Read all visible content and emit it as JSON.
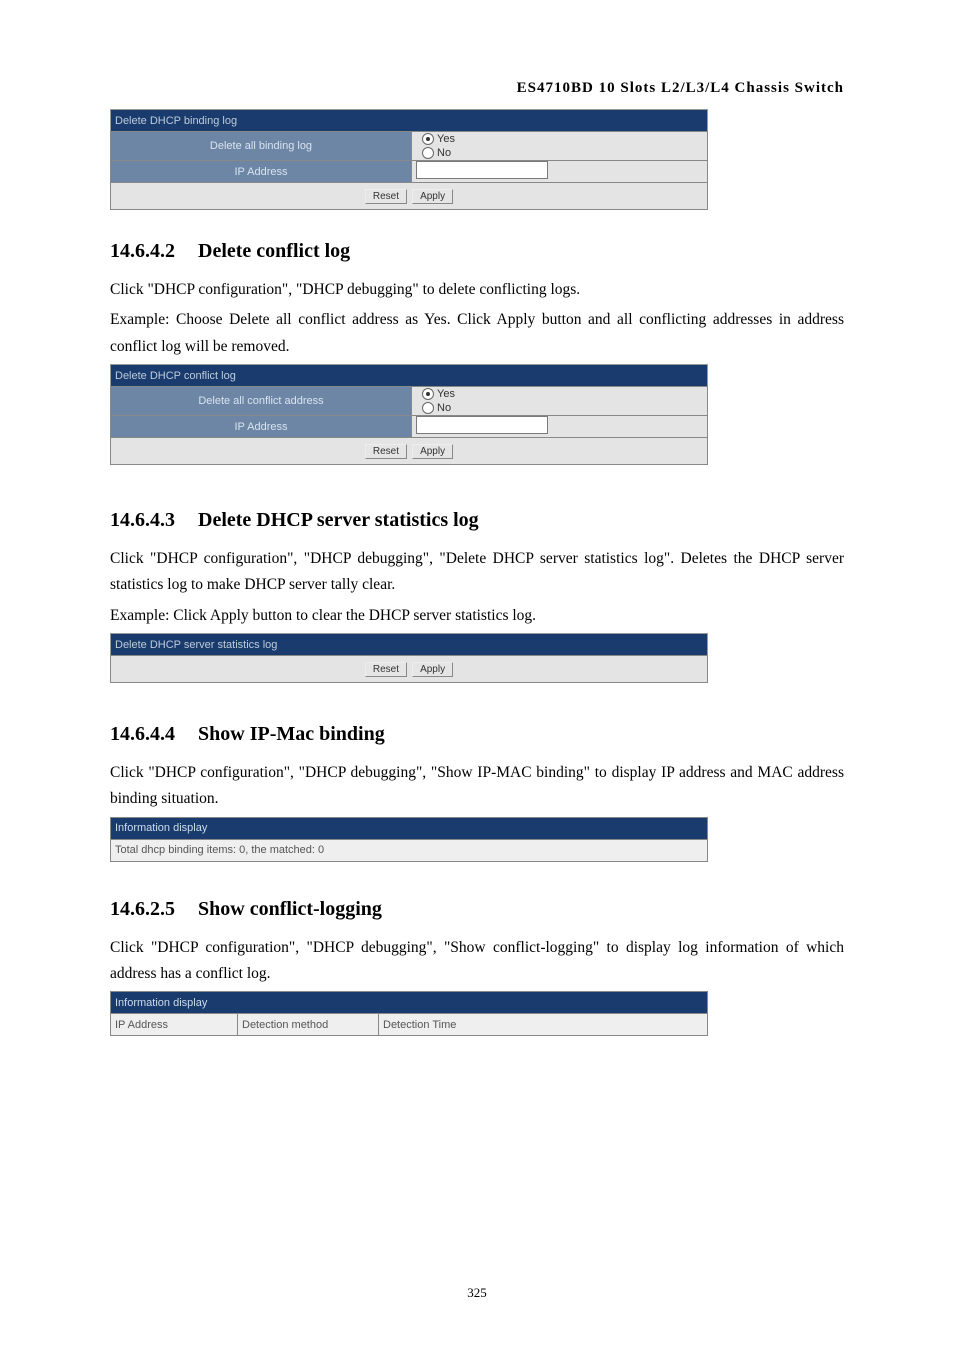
{
  "header": "ES4710BD 10 Slots L2/L3/L4 Chassis Switch",
  "form1": {
    "title": "Delete DHCP binding log",
    "row1_label": "Delete all binding log",
    "radio_yes": "Yes",
    "radio_no": "No",
    "row2_label": "IP Address",
    "btn_reset": "Reset",
    "btn_apply": "Apply"
  },
  "sec2": {
    "num": "14.6.4.2",
    "title": "Delete conflict log",
    "p1": "Click \"DHCP configuration\", \"DHCP debugging\" to delete conflicting logs.",
    "p2": "Example: Choose Delete all conflict address as Yes. Click Apply button and all conflicting addresses in address conflict log will be removed."
  },
  "form2": {
    "title": "Delete DHCP conflict log",
    "row1_label": "Delete all conflict address",
    "radio_yes": "Yes",
    "radio_no": "No",
    "row2_label": "IP Address",
    "btn_reset": "Reset",
    "btn_apply": "Apply"
  },
  "sec3": {
    "num": "14.6.4.3",
    "title": "Delete DHCP server statistics log",
    "p1": "Click \"DHCP configuration\", \"DHCP debugging\", \"Delete DHCP server statistics log\". Deletes the DHCP server statistics log to make DHCP server tally clear.",
    "p2": "Example: Click Apply button to clear the DHCP server statistics log."
  },
  "form3": {
    "title": "Delete DHCP server statistics log",
    "btn_reset": "Reset",
    "btn_apply": "Apply"
  },
  "sec4": {
    "num": "14.6.4.4",
    "title": "Show IP-Mac binding",
    "p1": "Click \"DHCP configuration\", \"DHCP debugging\", \"Show IP-MAC binding\" to display IP address and MAC address binding situation."
  },
  "info1": {
    "header": "Information display",
    "body": "Total dhcp binding items: 0, the matched: 0"
  },
  "sec5": {
    "num": "14.6.2.5",
    "title": "Show conflict-logging",
    "p1": "Click \"DHCP configuration\", \"DHCP debugging\", \"Show conflict-logging\" to display log information of which address has a conflict log."
  },
  "info2": {
    "header": "Information display",
    "col1": "IP Address",
    "col2": "Detection method",
    "col3": "Detection Time"
  },
  "page_number": "325"
}
